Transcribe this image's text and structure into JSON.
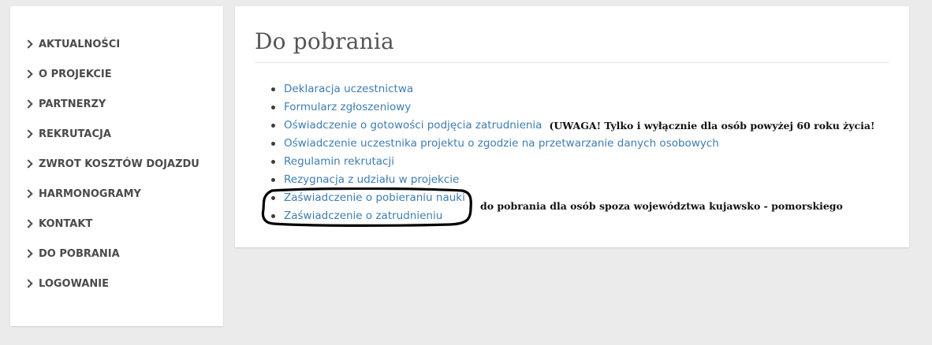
{
  "sidebar": {
    "items": [
      {
        "label": "AKTUALNOŚCI"
      },
      {
        "label": "O PROJEKCIE"
      },
      {
        "label": "PARTNERZY"
      },
      {
        "label": "REKRUTACJA"
      },
      {
        "label": "ZWROT KOSZTÓW DOJAZDU"
      },
      {
        "label": "HARMONOGRAMY"
      },
      {
        "label": "KONTAKT"
      },
      {
        "label": "DO POBRANIA"
      },
      {
        "label": "LOGOWANIE"
      }
    ]
  },
  "main": {
    "title": "Do pobrania",
    "downloads": [
      {
        "label": "Deklaracja uczestnictwa"
      },
      {
        "label": "Formularz zgłoszeniowy"
      },
      {
        "label": "Oświadczenie o gotowości podjęcia zatrudnienia",
        "note": "(UWAGA! Tylko i wyłącznie dla osób powyżej 60 roku życia!"
      },
      {
        "label": "Oświadczenie uczestnika projektu o zgodzie na przetwarzanie danych osobowych"
      },
      {
        "label": "Regulamin rekrutacji"
      },
      {
        "label": "Rezygnacja z udziału w projekcie"
      },
      {
        "label": "Zaświadczenie o pobieraniu nauki"
      },
      {
        "label": "Zaświadczenie o zatrudnieniu"
      }
    ],
    "outside_note": "do pobrania dla osób spoza województwa kujawsko - pomorskiego"
  },
  "colors": {
    "link": "#3e7db0",
    "nav_text": "#4a4a4a",
    "page_bg": "#ebebeb"
  }
}
